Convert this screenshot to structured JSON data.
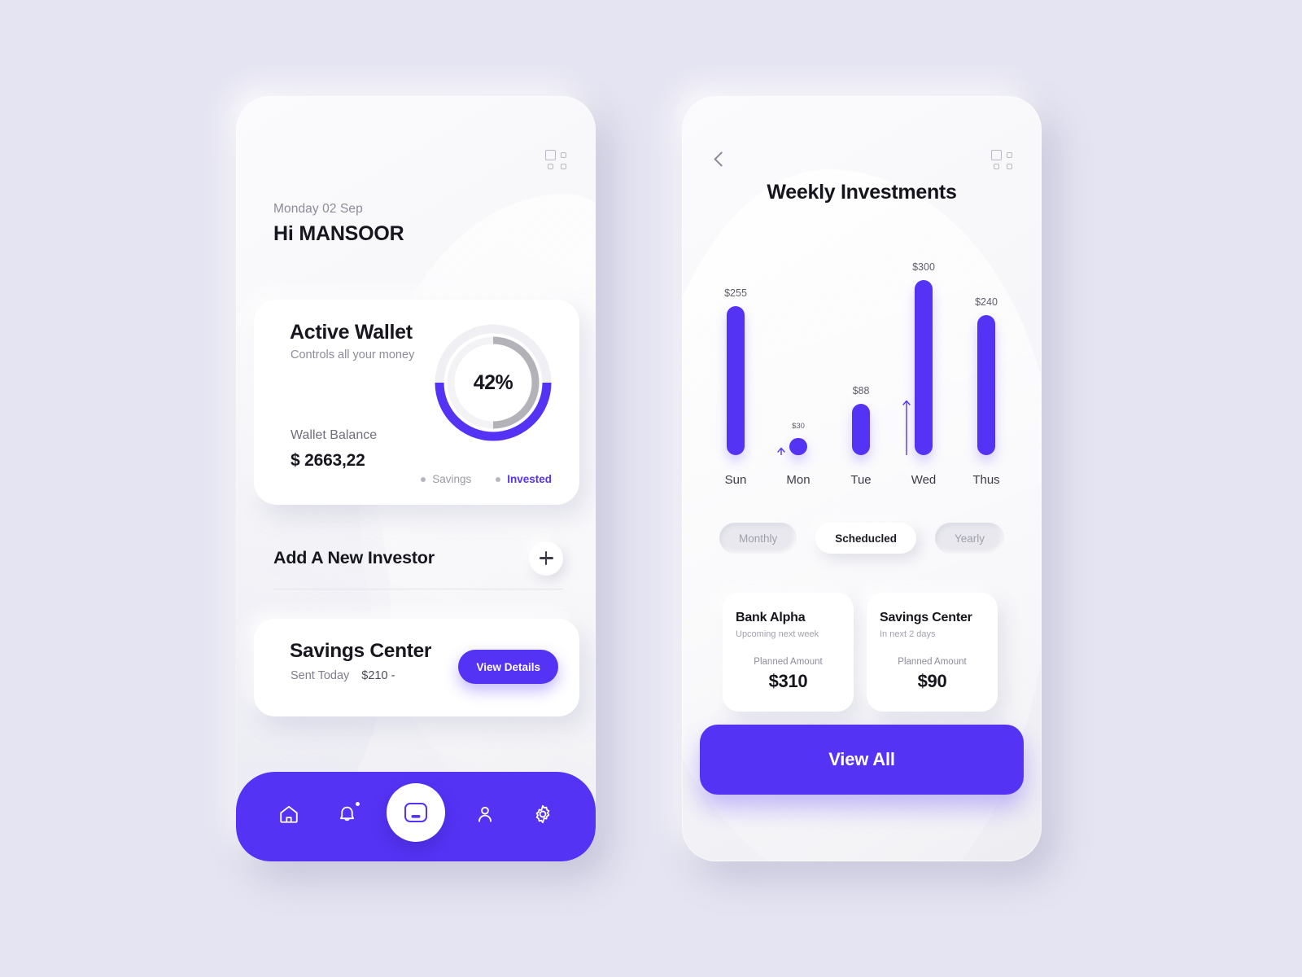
{
  "theme": {
    "accent": "#5533f5",
    "page_background": "#e5e4f2",
    "card_background": "#ffffff",
    "muted_text": "#8b8b99"
  },
  "home_screen": {
    "grid_icon": "grid-icon",
    "date": "Monday 02 Sep",
    "greeting": "Hi MANSOOR",
    "wallet_card": {
      "title": "Active Wallet",
      "subtitle": "Controls all your money",
      "balance_label": "Wallet Balance",
      "balance_value": "$ 2663,22",
      "progress_text": "42%",
      "progress_percent": 42,
      "legend": [
        {
          "label": "Savings",
          "color": "#9a9aa6"
        },
        {
          "label": "Invested",
          "color": "#5533f5"
        }
      ]
    },
    "add_investor": {
      "label": "Add A New Investor",
      "button_icon": "plus-icon"
    },
    "savings_card": {
      "title": "Savings Center",
      "sent_label": "Sent Today",
      "sent_amount": "$210 -",
      "button_label": "View Details"
    },
    "nav_items": [
      {
        "icon": "home-icon",
        "active": false
      },
      {
        "icon": "bell-icon",
        "active": false
      },
      {
        "icon": "wallet-icon",
        "active": true
      },
      {
        "icon": "person-icon",
        "active": false
      },
      {
        "icon": "gear-icon",
        "active": false
      }
    ]
  },
  "investments_screen": {
    "back_icon": "chevron-left-icon",
    "grid_icon": "grid-icon",
    "title": "Weekly Investments",
    "filters": [
      {
        "label": "Monthly",
        "active": false
      },
      {
        "label": "Scheducled",
        "active": true
      },
      {
        "label": "Yearly",
        "active": false
      }
    ],
    "plan_cards": [
      {
        "name": "Bank Alpha",
        "when": "Upcoming next week",
        "amount_label": "Planned Amount",
        "amount": "$310"
      },
      {
        "name": "Savings Center",
        "when": "In next 2 days",
        "amount_label": "Planned Amount",
        "amount": "$90"
      }
    ],
    "view_all_label": "View All"
  },
  "chart_data": {
    "type": "bar",
    "title": "Weekly Investments",
    "xlabel": "",
    "ylabel": "",
    "ylim": [
      0,
      300
    ],
    "grid": false,
    "legend": "none",
    "categories": [
      "Sun",
      "Mon",
      "Tue",
      "Wed",
      "Thus"
    ],
    "values": [
      255,
      30,
      88,
      300,
      240
    ],
    "value_labels": [
      "$255",
      "$30",
      "$88",
      "$300",
      "$240"
    ],
    "annotations": [
      {
        "category": "Mon",
        "type": "up-arrow"
      },
      {
        "category": "Wed",
        "type": "up-arrow"
      }
    ],
    "bar_color": "#5533f5"
  }
}
